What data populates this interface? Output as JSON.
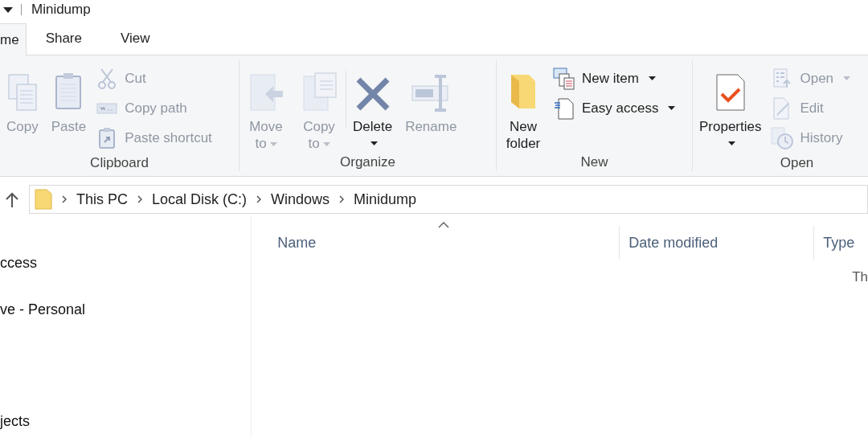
{
  "window": {
    "title": "Minidump"
  },
  "tabs": [
    {
      "label": "me",
      "selected": true
    },
    {
      "label": "Share",
      "selected": false
    },
    {
      "label": "View",
      "selected": false
    }
  ],
  "ribbon": {
    "groups": [
      {
        "label": "Clipboard",
        "items": [
          {
            "kind": "large",
            "label": "Copy",
            "disabled": true,
            "dropdown": false
          },
          {
            "kind": "large",
            "label": "Paste",
            "disabled": true,
            "dropdown": false
          },
          {
            "kind": "small",
            "label": "Cut",
            "disabled": true,
            "dropdown": false
          },
          {
            "kind": "small",
            "label": "Copy path",
            "disabled": true,
            "dropdown": false
          },
          {
            "kind": "small",
            "label": "Paste shortcut",
            "disabled": true,
            "dropdown": false
          }
        ]
      },
      {
        "label": "Organize",
        "items": [
          {
            "kind": "large",
            "label": "Move to",
            "disabled": true,
            "dropdown": true
          },
          {
            "kind": "large",
            "label": "Copy to",
            "disabled": true,
            "dropdown": true
          },
          {
            "kind": "large",
            "label": "Delete",
            "disabled": false,
            "dropdown": true
          },
          {
            "kind": "large",
            "label": "Rename",
            "disabled": true,
            "dropdown": false
          }
        ]
      },
      {
        "label": "New",
        "items": [
          {
            "kind": "large",
            "label": "New folder",
            "disabled": false,
            "dropdown": false
          },
          {
            "kind": "small",
            "label": "New item",
            "disabled": false,
            "dropdown": true
          },
          {
            "kind": "small",
            "label": "Easy access",
            "disabled": false,
            "dropdown": true
          }
        ]
      },
      {
        "label": "Open",
        "items": [
          {
            "kind": "large",
            "label": "Properties",
            "disabled": false,
            "dropdown": true
          },
          {
            "kind": "small",
            "label": "Open",
            "disabled": true,
            "dropdown": true
          },
          {
            "kind": "small",
            "label": "Edit",
            "disabled": true,
            "dropdown": false
          },
          {
            "kind": "small",
            "label": "History",
            "disabled": true,
            "dropdown": false
          }
        ]
      }
    ]
  },
  "address": {
    "crumbs": [
      "This PC",
      "Local Disk (C:)",
      "Windows",
      "Minidump"
    ]
  },
  "navigation": {
    "items": [
      "ccess",
      "ve - Personal",
      "jects"
    ]
  },
  "file_list": {
    "columns": [
      "Name",
      "Date modified",
      "Type"
    ],
    "empty_message": "Th"
  }
}
